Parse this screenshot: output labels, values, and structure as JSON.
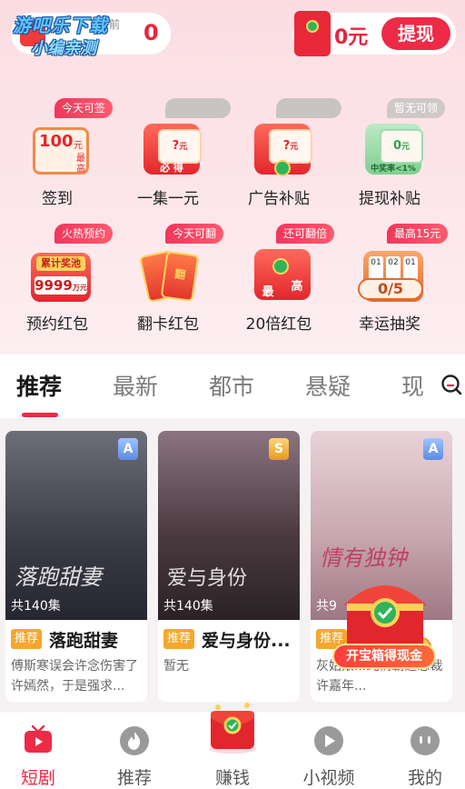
{
  "header": {
    "coin_today_label": "当前",
    "coin_value": "0",
    "watermark_line1": "游吧乐下载",
    "watermark_line2": "小编亲测",
    "cash_value": "0元",
    "withdraw_label": "提现"
  },
  "grid": [
    {
      "label": "签到",
      "badge": "今天可签",
      "icon": "calendar-icon",
      "amount": "100",
      "unit": "元",
      "side": "最高"
    },
    {
      "label": "一集一元",
      "badge": "",
      "icon": "red-envelope-icon",
      "amount": "?",
      "unit": "元",
      "text": "必 得"
    },
    {
      "label": "广告补贴",
      "badge": "",
      "icon": "red-envelope-icon",
      "amount": "?",
      "unit": "元"
    },
    {
      "label": "提现补贴",
      "badge": "暂无可领",
      "icon": "green-envelope-icon",
      "amount": "0",
      "unit": "元",
      "text": "中奖率<1%"
    },
    {
      "label": "预约红包",
      "badge": "火热预约",
      "icon": "prize-pool-icon",
      "pool_label": "累计奖池",
      "pool_value": "9999",
      "pool_unit": "万元"
    },
    {
      "label": "翻卡红包",
      "badge": "今天可翻",
      "icon": "flip-card-icon",
      "card_text": "翻"
    },
    {
      "label": "20倍红包",
      "badge": "还可翻倍",
      "icon": "red-envelope-icon",
      "text_left": "最",
      "text_right": "高"
    },
    {
      "label": "幸运抽奖",
      "badge": "最高15元",
      "icon": "lottery-icon",
      "progress": "0/5",
      "slots": [
        "01",
        "02",
        "01"
      ]
    }
  ],
  "tabs": [
    "推荐",
    "最新",
    "都市",
    "悬疑",
    "现"
  ],
  "cards": [
    {
      "title": "落跑甜妻",
      "tag": "推荐",
      "episodes": "共140集",
      "grade": "A",
      "desc": "傅斯寒误会许念伤害了许嫣然，于是强求...",
      "poster_title": "落跑甜妻",
      "poster_color": "#3a3a46"
    },
    {
      "title": "爱与身份...",
      "tag": "推荐",
      "episodes": "共140集",
      "grade": "S",
      "desc": "暂无",
      "poster_title": "爱与身份",
      "poster_color": "#4a3a40"
    },
    {
      "title": "",
      "tag": "推荐",
      "episodes": "共9",
      "grade": "A",
      "desc": "灰姑娘...纯情霸道总裁许嘉年...",
      "poster_title": "情有独钟",
      "poster_color": "#c9a8b0"
    }
  ],
  "floating": {
    "chest_label": "开宝箱得现金"
  },
  "bottom_nav": [
    {
      "label": "短剧",
      "icon": "tv-icon",
      "active": true
    },
    {
      "label": "推荐",
      "icon": "flame-icon",
      "active": false
    },
    {
      "label": "赚钱",
      "icon": "gift-envelope-icon",
      "active": false
    },
    {
      "label": "小视频",
      "icon": "play-icon",
      "active": false
    },
    {
      "label": "我的",
      "icon": "profile-icon",
      "active": false
    }
  ]
}
